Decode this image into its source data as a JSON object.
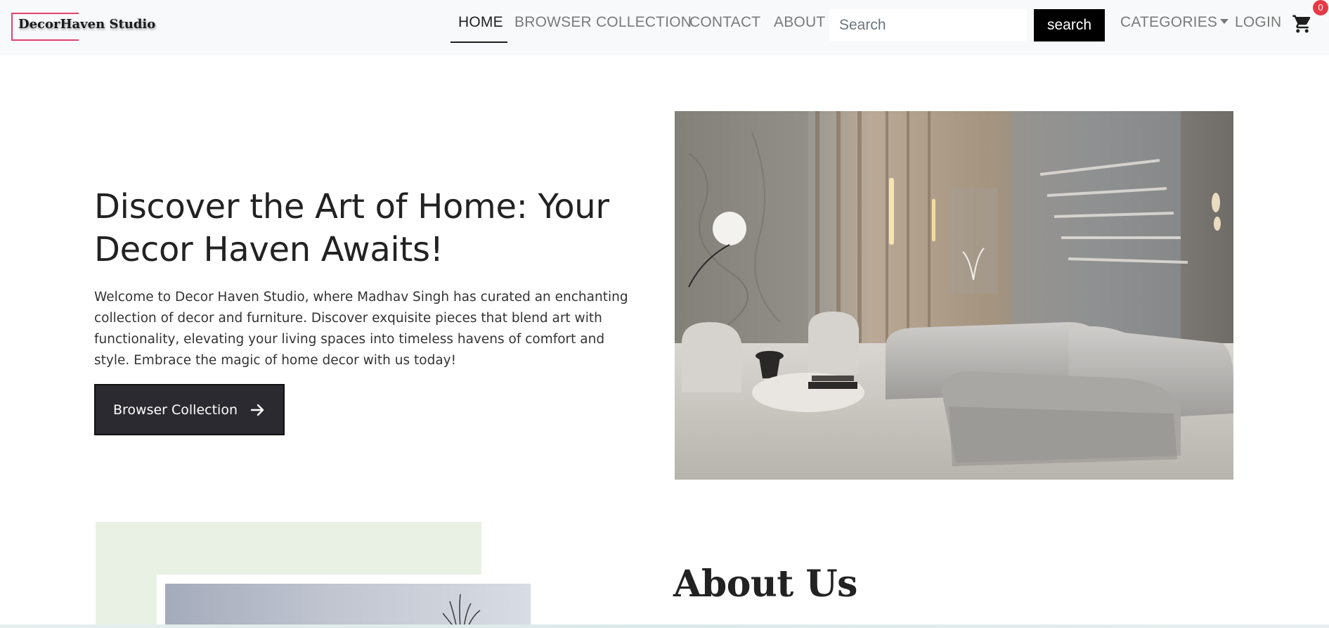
{
  "brand": {
    "name": "DecorHaven Studio",
    "accent": "#e0436e"
  },
  "nav": {
    "home": "HOME",
    "browser_collection": "BROWSER COLLECTION",
    "contact": "CONTACT",
    "about": "ABOUT",
    "search_placeholder": "Search",
    "search_button": "search",
    "categories": "CATEGORIES",
    "login": "LOGIN",
    "cart_icon": "cart-icon",
    "cart_count": "0"
  },
  "hero": {
    "title": "Discover the Art of Home: Your Decor Haven Awaits!",
    "description": "Welcome to Decor Haven Studio, where Madhav Singh has curated an enchanting collection of decor and furniture. Discover exquisite pieces that blend art with functionality, elevating your living spaces into timeless havens of comfort and style. Embrace the magic of home decor with us today!",
    "button_label": "Browser Collection",
    "button_icon": "arrow-right-icon"
  },
  "about": {
    "title": "About Us",
    "bg_color": "#e8f1e4"
  }
}
